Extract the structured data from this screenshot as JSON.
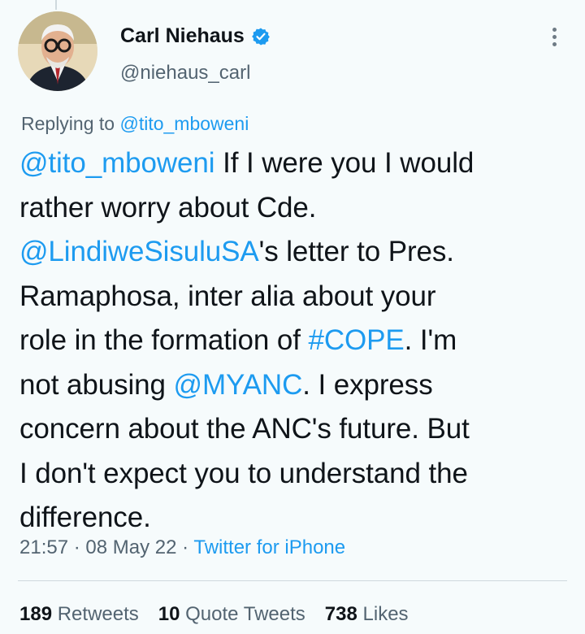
{
  "author": {
    "name": "Carl Niehaus",
    "handle": "@niehaus_carl",
    "verified": true
  },
  "reply": {
    "prefix": "Replying to",
    "to": "@tito_mboweni"
  },
  "tweet": {
    "parts": [
      {
        "t": "@tito_mboweni",
        "link": true
      },
      {
        "t": " If I were you I would",
        "link": false
      },
      {
        "br": true
      },
      {
        "t": "rather worry about Cde.",
        "link": false
      },
      {
        "br": true
      },
      {
        "t": "@LindiweSisuluSA",
        "link": true
      },
      {
        "t": "'s letter to Pres.",
        "link": false
      },
      {
        "br": true
      },
      {
        "t": "Ramaphosa, inter alia about your",
        "link": false
      },
      {
        "br": true
      },
      {
        "t": "role in the formation of ",
        "link": false
      },
      {
        "t": "#COPE",
        "link": true
      },
      {
        "t": ". I'm",
        "link": false
      },
      {
        "br": true
      },
      {
        "t": "not abusing ",
        "link": false
      },
      {
        "t": "@MYANC",
        "link": true
      },
      {
        "t": ". I express",
        "link": false
      },
      {
        "br": true
      },
      {
        "t": "concern about the ANC's future. But",
        "link": false
      },
      {
        "br": true
      },
      {
        "t": "I don't expect you to understand the",
        "link": false
      },
      {
        "br": true
      },
      {
        "t": "difference.",
        "link": false
      }
    ]
  },
  "meta": {
    "time": "21:57",
    "sep1": " · ",
    "date": "08 May 22",
    "sep2": " · ",
    "source": "Twitter for iPhone"
  },
  "stats": {
    "retweets_count": "189",
    "retweets_label": "Retweets",
    "quotes_count": "10",
    "quotes_label": "Quote Tweets",
    "likes_count": "738",
    "likes_label": "Likes"
  },
  "colors": {
    "link": "#1d9bf0",
    "muted": "#536471",
    "text": "#0f1419"
  }
}
